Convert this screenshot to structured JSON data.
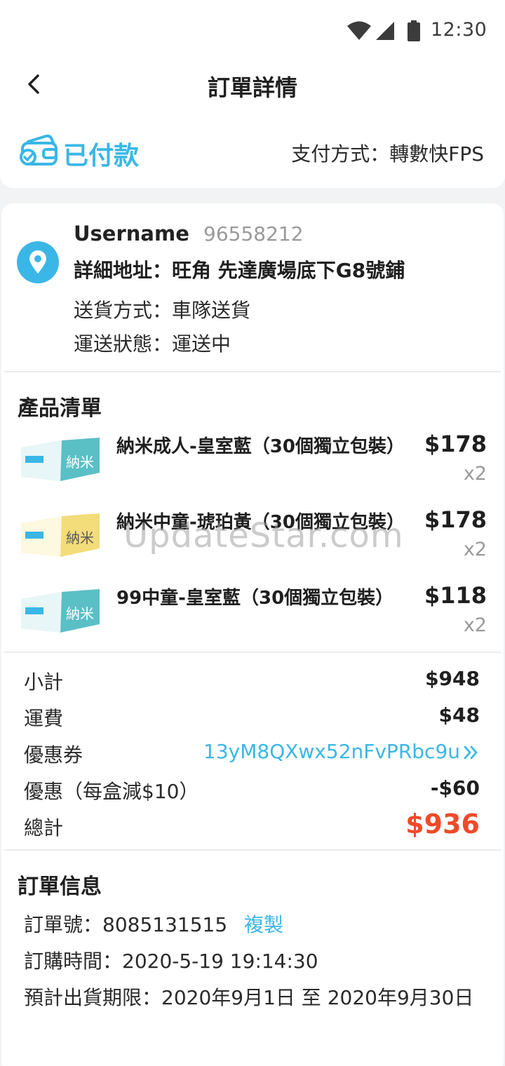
{
  "status_bar": {
    "time": "12:30"
  },
  "header": {
    "title": "訂單詳情"
  },
  "payment": {
    "status": "已付款",
    "method": "支付方式：轉數快FPS"
  },
  "recipient": {
    "username": "Username",
    "phone": "96558212",
    "address": "詳細地址：旺角 先達廣場底下G8號鋪",
    "delivery": "送貨方式：車隊送貨",
    "shipping_status": "運送狀態：運送中"
  },
  "products": {
    "title": "產品清單",
    "items": [
      {
        "name": "納米成人-皇室藍（30個獨立包裝）",
        "price": "$178",
        "qty": "x2",
        "color": "#5bbfc6"
      },
      {
        "name": "納米中童-琥珀黃（30個獨立包裝）",
        "price": "$178",
        "qty": "x2",
        "color": "#f3dc7a"
      },
      {
        "name": "99中童-皇室藍（30個獨立包裝）",
        "price": "$118",
        "qty": "x2",
        "color": "#5bbfc6"
      }
    ]
  },
  "watermark": "UpdateStar.com",
  "summary": {
    "subtotal_label": "小計",
    "subtotal": "$948",
    "shipping_label": "運費",
    "shipping": "$48",
    "coupon_label": "優惠券",
    "coupon": "13yM8QXwx52nFvPRbc9u",
    "discount_label": "優惠（每盒減$10）",
    "discount": "-$60",
    "total_label": "總計",
    "total": "$936"
  },
  "order_info": {
    "title": "訂單信息",
    "order_no": "訂單號：8085131515",
    "copy": "複製",
    "order_time": "訂購時間：2020-5-19 19:14:30",
    "ship_deadline": "預計出貨期限：2020年9月1日 至 2020年9月30日"
  },
  "colors": {
    "accent": "#3ab7e6",
    "total": "#f04a28"
  }
}
